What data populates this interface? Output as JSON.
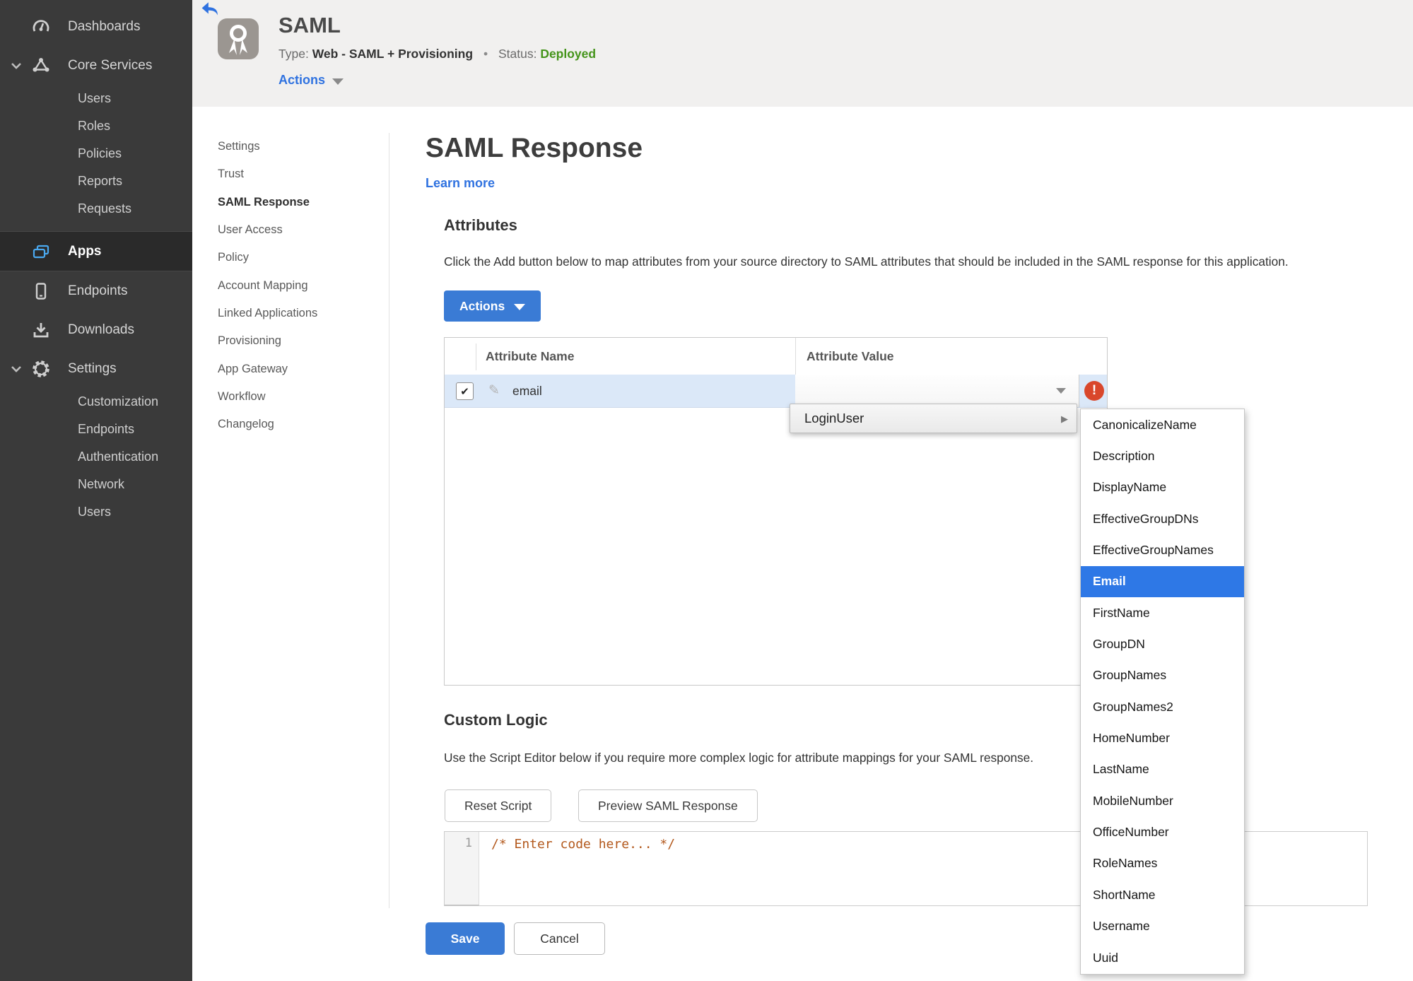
{
  "sidebar": {
    "items": [
      {
        "label": "Dashboards"
      },
      {
        "label": "Core Services",
        "children": [
          "Users",
          "Roles",
          "Policies",
          "Reports",
          "Requests"
        ]
      },
      {
        "label": "Apps"
      },
      {
        "label": "Endpoints"
      },
      {
        "label": "Downloads"
      },
      {
        "label": "Settings",
        "children": [
          "Customization",
          "Endpoints",
          "Authentication",
          "Network",
          "Users"
        ]
      }
    ]
  },
  "header": {
    "title": "SAML",
    "type_label": "Type:",
    "type_value": "Web - SAML + Provisioning",
    "separator": "•",
    "status_label": "Status:",
    "status_value": "Deployed",
    "actions_label": "Actions"
  },
  "subnav": {
    "items": [
      "Settings",
      "Trust",
      "SAML Response",
      "User Access",
      "Policy",
      "Account Mapping",
      "Linked Applications",
      "Provisioning",
      "App Gateway",
      "Workflow",
      "Changelog"
    ],
    "active": "SAML Response"
  },
  "main": {
    "page_title": "SAML Response",
    "learn_more": "Learn more",
    "attributes": {
      "heading": "Attributes",
      "description": "Click the Add button below to map attributes from your source directory to SAML attributes that should be included in the SAML response for this application.",
      "actions_button": "Actions"
    },
    "table": {
      "columns": [
        "Attribute Name",
        "Attribute Value"
      ],
      "rows": [
        {
          "checked": true,
          "name": "email",
          "value": ""
        }
      ]
    },
    "value_menu": {
      "label": "LoginUser"
    },
    "attribute_submenu": {
      "items": [
        "CanonicalizeName",
        "Description",
        "DisplayName",
        "EffectiveGroupDNs",
        "EffectiveGroupNames",
        "Email",
        "FirstName",
        "GroupDN",
        "GroupNames",
        "GroupNames2",
        "HomeNumber",
        "LastName",
        "MobileNumber",
        "OfficeNumber",
        "RoleNames",
        "ShortName",
        "Username",
        "Uuid"
      ],
      "selected": "Email"
    },
    "custom_logic": {
      "heading": "Custom Logic",
      "description": "Use the Script Editor below if you require more complex logic for attribute mappings for your SAML response.",
      "reset_button": "Reset Script",
      "preview_button": "Preview SAML Response"
    },
    "editor": {
      "line_number": "1",
      "code": "/* Enter code here... */"
    },
    "footer": {
      "save": "Save",
      "cancel": "Cancel"
    }
  },
  "icons": {
    "checkbox_check": "✔",
    "edit_pencil": "✎",
    "submenu_arrow": "▶"
  },
  "colors": {
    "accent_blue": "#3a7bd5",
    "link_blue": "#2f72e0",
    "status_green": "#44941a",
    "error_red": "#d9472b",
    "selected_row_blue": "#dbe8f8",
    "menu_selected_blue": "#2e78e6",
    "code_orange": "#b3591d",
    "sidebar_bg": "#3a3a3a",
    "app_icon_gray": "#9b9691"
  }
}
